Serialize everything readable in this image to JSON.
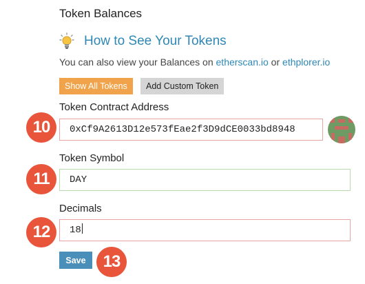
{
  "section": {
    "title": "Token Balances",
    "howto_link": "How to See Your Tokens",
    "also_prefix": "You can also view your Balances on ",
    "also_link1": "etherscan.io",
    "also_mid": " or ",
    "also_link2": "ethplorer.io"
  },
  "tabs": {
    "show_all": "Show All Tokens",
    "add_custom": "Add Custom Token"
  },
  "form": {
    "contract_label": "Token Contract Address",
    "contract_value": "0xCf9A2613D12e573fEae2f3D9dCE0033bd8948",
    "symbol_label": "Token Symbol",
    "symbol_value": "DAY",
    "decimals_label": "Decimals",
    "decimals_value": "18",
    "save_label": "Save"
  },
  "badges": {
    "b10": "10",
    "b11": "11",
    "b12": "12",
    "b13": "13"
  },
  "colors": {
    "accent": "#2e87b4",
    "show_all_bg": "#f0a34a",
    "save_bg": "#4a8fb9",
    "badge_bg": "#e8553b",
    "error_border": "#e8a4a0",
    "valid_border": "#b8dcb0"
  },
  "icons": {
    "howto": "lightbulb-icon",
    "address": "identicon-avatar"
  }
}
